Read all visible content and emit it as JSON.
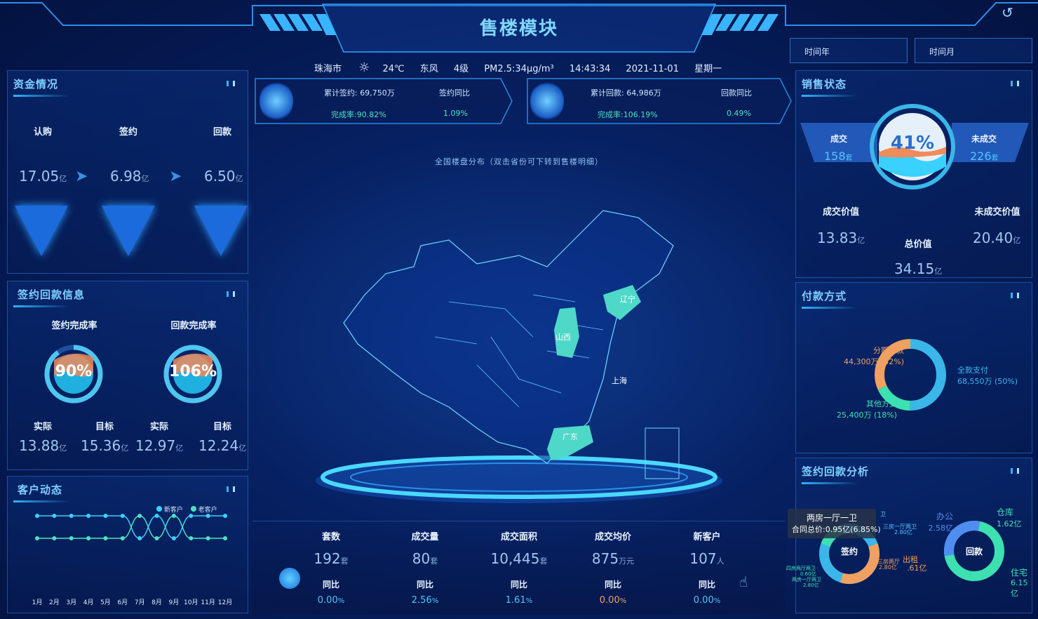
{
  "header": {
    "title": "售楼模块",
    "back_icon": "back-arrow-icon"
  },
  "weather": {
    "city": "珠海市",
    "icon": "sun-icon",
    "temp": "24℃",
    "wind_dir": "东风",
    "wind_level": "4级",
    "pm": "PM2.5:34μg/m³",
    "time": "14:43:34",
    "date": "2021-11-01",
    "weekday": "星期一"
  },
  "filters": {
    "year": "时间年",
    "month": "时间月"
  },
  "funds": {
    "title": "资金情况",
    "items": [
      {
        "label": "认购",
        "value": "17.05",
        "unit": "亿"
      },
      {
        "label": "签约",
        "value": "6.98",
        "unit": "亿"
      },
      {
        "label": "回款",
        "value": "6.50",
        "unit": "亿"
      }
    ]
  },
  "sign_return": {
    "title": "签约回款信息",
    "gauges": [
      {
        "label": "签约完成率",
        "percent": "90%",
        "fraction": 0.9,
        "actual_label": "实际",
        "actual": "13.88",
        "target_label": "目标",
        "target": "15.36",
        "unit": "亿"
      },
      {
        "label": "回款完成率",
        "percent": "106%",
        "fraction": 1.0,
        "actual_label": "实际",
        "actual": "12.97",
        "target_label": "目标",
        "target": "12.24",
        "unit": "亿"
      }
    ]
  },
  "customer": {
    "title": "客户动态",
    "legend": [
      {
        "name": "新客户",
        "color": "#3ad1ff"
      },
      {
        "name": "老客户",
        "color": "#4fe0c0"
      }
    ]
  },
  "chart_data": {
    "type": "line",
    "categories": [
      "1月",
      "2月",
      "3月",
      "4月",
      "5月",
      "6月",
      "7月",
      "8月",
      "9月",
      "10月",
      "11月",
      "12月"
    ],
    "series": [
      {
        "name": "新客户",
        "values": [
          3,
          3,
          3,
          3,
          3,
          3,
          1,
          3,
          1,
          3,
          3,
          3
        ]
      },
      {
        "name": "老客户",
        "values": [
          1,
          1,
          1,
          1,
          1,
          1,
          3,
          1,
          3,
          1,
          1,
          1
        ]
      }
    ],
    "ylim": [
      0,
      4
    ],
    "grid": false,
    "legend": "top-right"
  },
  "kpi": [
    {
      "label1": "累计签约:",
      "value1": "69,750万",
      "label2": "签约同比",
      "value2": "1.09%",
      "rate_label": "完成率:",
      "rate": "90.82%"
    },
    {
      "label1": "累计回款:",
      "value1": "64,986万",
      "label2": "回款同比",
      "value2": "0.49%",
      "rate_label": "完成率:",
      "rate": "106.19%"
    }
  ],
  "map": {
    "caption": "全国楼盘分布（双击省份可下转到售楼明细）",
    "provinces": [
      "山西",
      "辽宁",
      "上海",
      "广东"
    ]
  },
  "bottom_stats": [
    {
      "label": "套数",
      "value": "192",
      "unit": "套",
      "cmp_label": "同比",
      "cmp": "0.00",
      "cmp_unit": "%"
    },
    {
      "label": "成交量",
      "value": "80",
      "unit": "套",
      "cmp_label": "同比",
      "cmp": "2.56",
      "cmp_unit": "%"
    },
    {
      "label": "成交面积",
      "value": "10,445",
      "unit": "套",
      "cmp_label": "同比",
      "cmp": "1.61",
      "cmp_unit": "%"
    },
    {
      "label": "成交均价",
      "value": "875",
      "unit": "万元",
      "cmp_label": "同比",
      "cmp": "0.00",
      "cmp_unit": "%"
    },
    {
      "label": "新客户",
      "value": "107",
      "unit": "人",
      "cmp_label": "同比",
      "cmp": "0.00",
      "cmp_unit": "%"
    }
  ],
  "sales": {
    "title": "销售状态",
    "percent": "41%",
    "done_label": "成交",
    "done": "158",
    "done_unit": "套",
    "undone_label": "未成交",
    "undone": "226",
    "undone_unit": "套",
    "done_value_label": "成交价值",
    "done_value": "13.83",
    "undone_value_label": "未成交价值",
    "undone_value": "20.40",
    "total_label": "总价值",
    "total": "34.15",
    "unit": "亿"
  },
  "payment": {
    "title": "付款方式",
    "segments": [
      {
        "name": "全款支付",
        "value": "68,550万 (50%)",
        "fraction": 0.5,
        "color": "#3ab7e8"
      },
      {
        "name": "分期付款",
        "value": "44,300万 (32%)",
        "fraction": 0.32,
        "color": "#f0a060"
      },
      {
        "name": "其他方式",
        "value": "25,400万 (18%)",
        "fraction": 0.18,
        "color": "#3de0b0"
      }
    ]
  },
  "analysis": {
    "title": "签约回款分析",
    "tooltip_title": "两房一厅一卫",
    "tooltip_value": "合同总价:0.95亿(6.85%)",
    "sign_center": "签约",
    "return_center": "回款",
    "sign_labels": [
      {
        "text": "卫"
      },
      {
        "text": "三房一厅两卫"
      },
      {
        "text": "2.80亿"
      },
      {
        "text": "出租"
      },
      {
        "text": "三房两厅"
      },
      {
        "text": "2.80亿"
      },
      {
        "text": ".61亿"
      },
      {
        "text": "四房两厅两卫"
      },
      {
        "text": "0.60亿"
      },
      {
        "text": "两房一厅两卫"
      },
      {
        "text": "2.80亿"
      }
    ],
    "return_labels": [
      {
        "name": "办公",
        "value": "2.58亿"
      },
      {
        "name": "仓库",
        "value": "1.62亿"
      },
      {
        "name": "住宅",
        "value": "6.15亿"
      }
    ]
  }
}
